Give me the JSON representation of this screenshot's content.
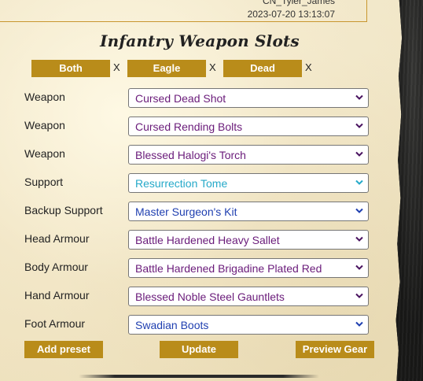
{
  "header": {
    "user_name": "CN_Tyler_James",
    "timestamp": "2023-07-20 13:13:07"
  },
  "page_title": "Infantry Weapon Slots",
  "filters": [
    {
      "label": "Both",
      "remove": "X"
    },
    {
      "label": "Eagle",
      "remove": "X"
    },
    {
      "label": "Dead",
      "remove": "X"
    }
  ],
  "slots": [
    {
      "label": "Weapon",
      "value": "Cursed Dead Shot",
      "color": "#6a1b7a"
    },
    {
      "label": "Weapon",
      "value": "Cursed Rending Bolts",
      "color": "#6a1b7a"
    },
    {
      "label": "Weapon",
      "value": "Blessed Halogi's Torch",
      "color": "#6a1b7a"
    },
    {
      "label": "Support",
      "value": "Resurrection Tome",
      "color": "#25a9c9"
    },
    {
      "label": "Backup Support",
      "value": "Master Surgeon's Kit",
      "color": "#1f3fb0"
    },
    {
      "label": "Head Armour",
      "value": "Battle Hardened Heavy Sallet",
      "color": "#6a1b7a"
    },
    {
      "label": "Body Armour",
      "value": "Battle Hardened Brigadine Plated Red",
      "color": "#6a1b7a"
    },
    {
      "label": "Hand Armour",
      "value": "Blessed Noble Steel Gauntlets",
      "color": "#6a1b7a"
    },
    {
      "label": "Foot Armour",
      "value": "Swadian Boots",
      "color": "#1f3fb0"
    }
  ],
  "buttons": {
    "add_preset": "Add preset",
    "update": "Update",
    "preview_gear": "Preview Gear"
  },
  "colors": {
    "accent": "#b98c1a",
    "header_border": "#c8962f"
  },
  "icons": {
    "select_arrow": "chevron-down-icon"
  }
}
